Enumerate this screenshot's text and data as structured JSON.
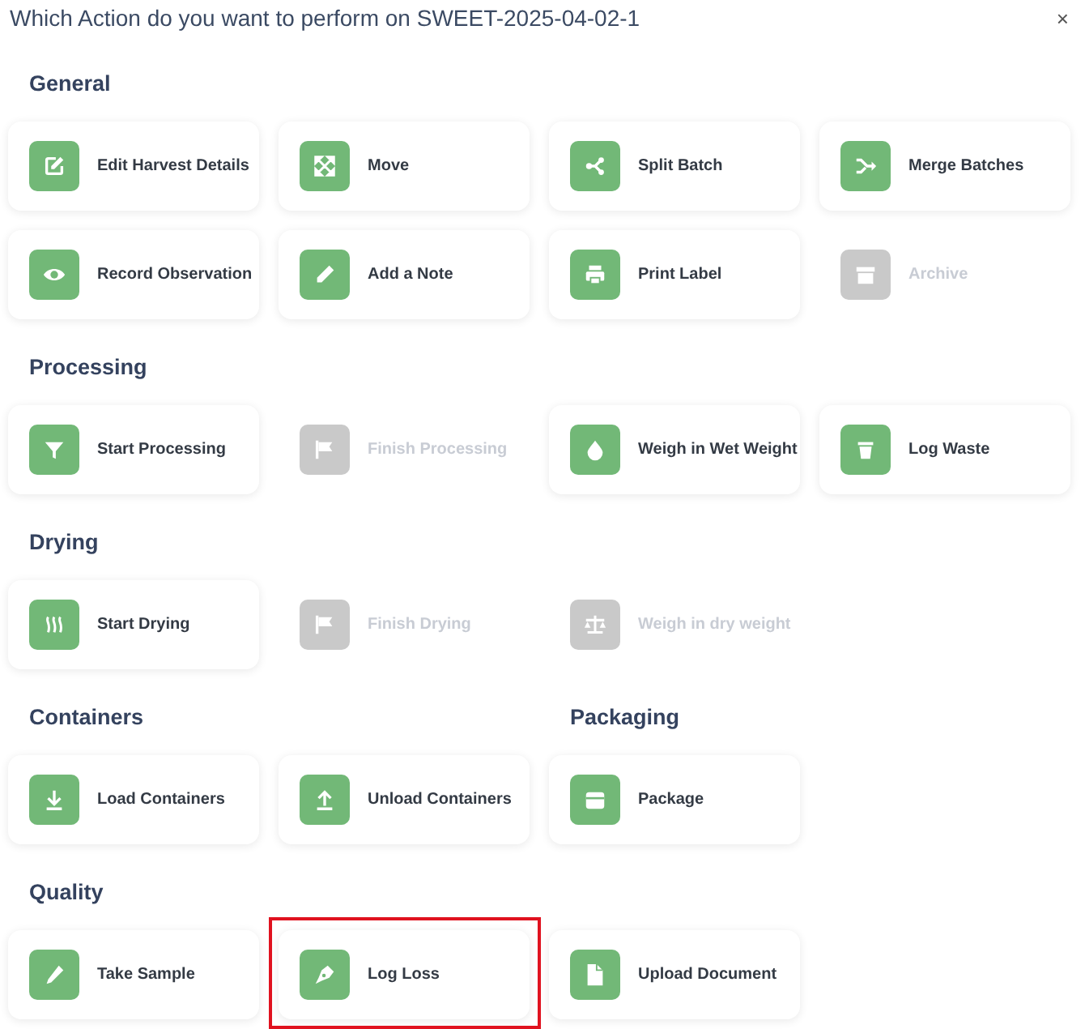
{
  "dialog": {
    "title": "Which Action do you want to perform on SWEET-2025-04-02-1",
    "close": "×"
  },
  "groups": [
    {
      "sections": [
        {
          "title": "General",
          "actions": [
            {
              "label": "Edit Harvest Details",
              "disabled": false,
              "highlighted": false
            },
            {
              "label": "Move",
              "disabled": false,
              "highlighted": false
            },
            {
              "label": "Split Batch",
              "disabled": false,
              "highlighted": false
            },
            {
              "label": "Merge Batches",
              "disabled": false,
              "highlighted": false
            },
            {
              "label": "Record Observation",
              "disabled": false,
              "highlighted": false
            },
            {
              "label": "Add a Note",
              "disabled": false,
              "highlighted": false
            },
            {
              "label": "Print Label",
              "disabled": false,
              "highlighted": false
            },
            {
              "label": "Archive",
              "disabled": true,
              "highlighted": false
            }
          ]
        }
      ]
    },
    {
      "sections": [
        {
          "title": "Processing",
          "actions": [
            {
              "label": "Start Processing",
              "disabled": false,
              "highlighted": false
            },
            {
              "label": "Finish Processing",
              "disabled": true,
              "highlighted": false
            },
            {
              "label": "Weigh in Wet Weight",
              "disabled": false,
              "highlighted": false
            },
            {
              "label": "Log Waste",
              "disabled": false,
              "highlighted": false
            }
          ]
        }
      ]
    },
    {
      "sections": [
        {
          "title": "Drying",
          "actions": [
            {
              "label": "Start Drying",
              "disabled": false,
              "highlighted": false
            },
            {
              "label": "Finish Drying",
              "disabled": true,
              "highlighted": false
            },
            {
              "label": "Weigh in dry weight",
              "disabled": true,
              "highlighted": false
            }
          ]
        }
      ]
    },
    {
      "sections": [
        {
          "title": "Containers",
          "actions": [
            {
              "label": "Load Containers",
              "disabled": false,
              "highlighted": false
            },
            {
              "label": "Unload Containers",
              "disabled": false,
              "highlighted": false
            }
          ]
        },
        {
          "title": "Packaging",
          "actions": [
            {
              "label": "Package",
              "disabled": false,
              "highlighted": false
            }
          ]
        }
      ]
    },
    {
      "sections": [
        {
          "title": "Quality",
          "actions": [
            {
              "label": "Take Sample",
              "disabled": false,
              "highlighted": false
            },
            {
              "label": "Log Loss",
              "disabled": false,
              "highlighted": true
            },
            {
              "label": "Upload Document",
              "disabled": false,
              "highlighted": false
            }
          ]
        }
      ]
    }
  ]
}
